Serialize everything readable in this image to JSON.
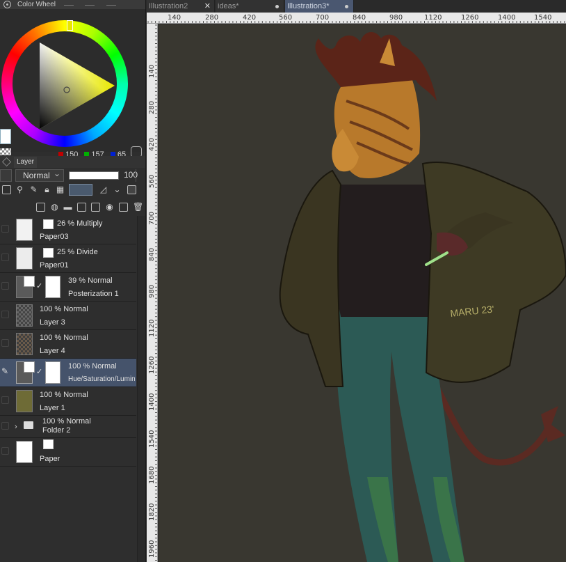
{
  "color_wheel": {
    "title": "Color Wheel",
    "rgb": {
      "r": "150",
      "g": "157",
      "b": "65"
    },
    "current_color": "#969d41"
  },
  "layer_panel": {
    "tab_label": "Layer",
    "blend_mode": "Normal",
    "opacity_value": "100",
    "layers": [
      {
        "mode": "26 % Multiply",
        "name": "Paper03"
      },
      {
        "mode": "25 % Divide",
        "name": "Paper01"
      },
      {
        "mode": "39 % Normal",
        "name": "Posterization 1"
      },
      {
        "mode": "100 % Normal",
        "name": "Layer 3"
      },
      {
        "mode": "100 % Normal",
        "name": "Layer 4"
      },
      {
        "mode": "100 % Normal",
        "name": "Hue/Saturation/Luminosity"
      },
      {
        "mode": "100 % Normal",
        "name": "Layer 1"
      },
      {
        "mode": "100 % Normal",
        "name": "Folder 2"
      },
      {
        "mode": "",
        "name": "Paper"
      }
    ]
  },
  "document_tabs": [
    {
      "label": "Illustration2"
    },
    {
      "label": "ideas*"
    },
    {
      "label": "Illustration3*"
    }
  ],
  "ruler": {
    "top": [
      "140",
      "280",
      "420",
      "560",
      "700",
      "840",
      "980",
      "1120",
      "1260",
      "1400",
      "1540"
    ],
    "left": [
      "140",
      "280",
      "420",
      "560",
      "700",
      "840",
      "980",
      "1120",
      "1260",
      "1400",
      "1540",
      "1680",
      "1820",
      "1960"
    ]
  },
  "artwork": {
    "signature": "MARU 23'"
  }
}
